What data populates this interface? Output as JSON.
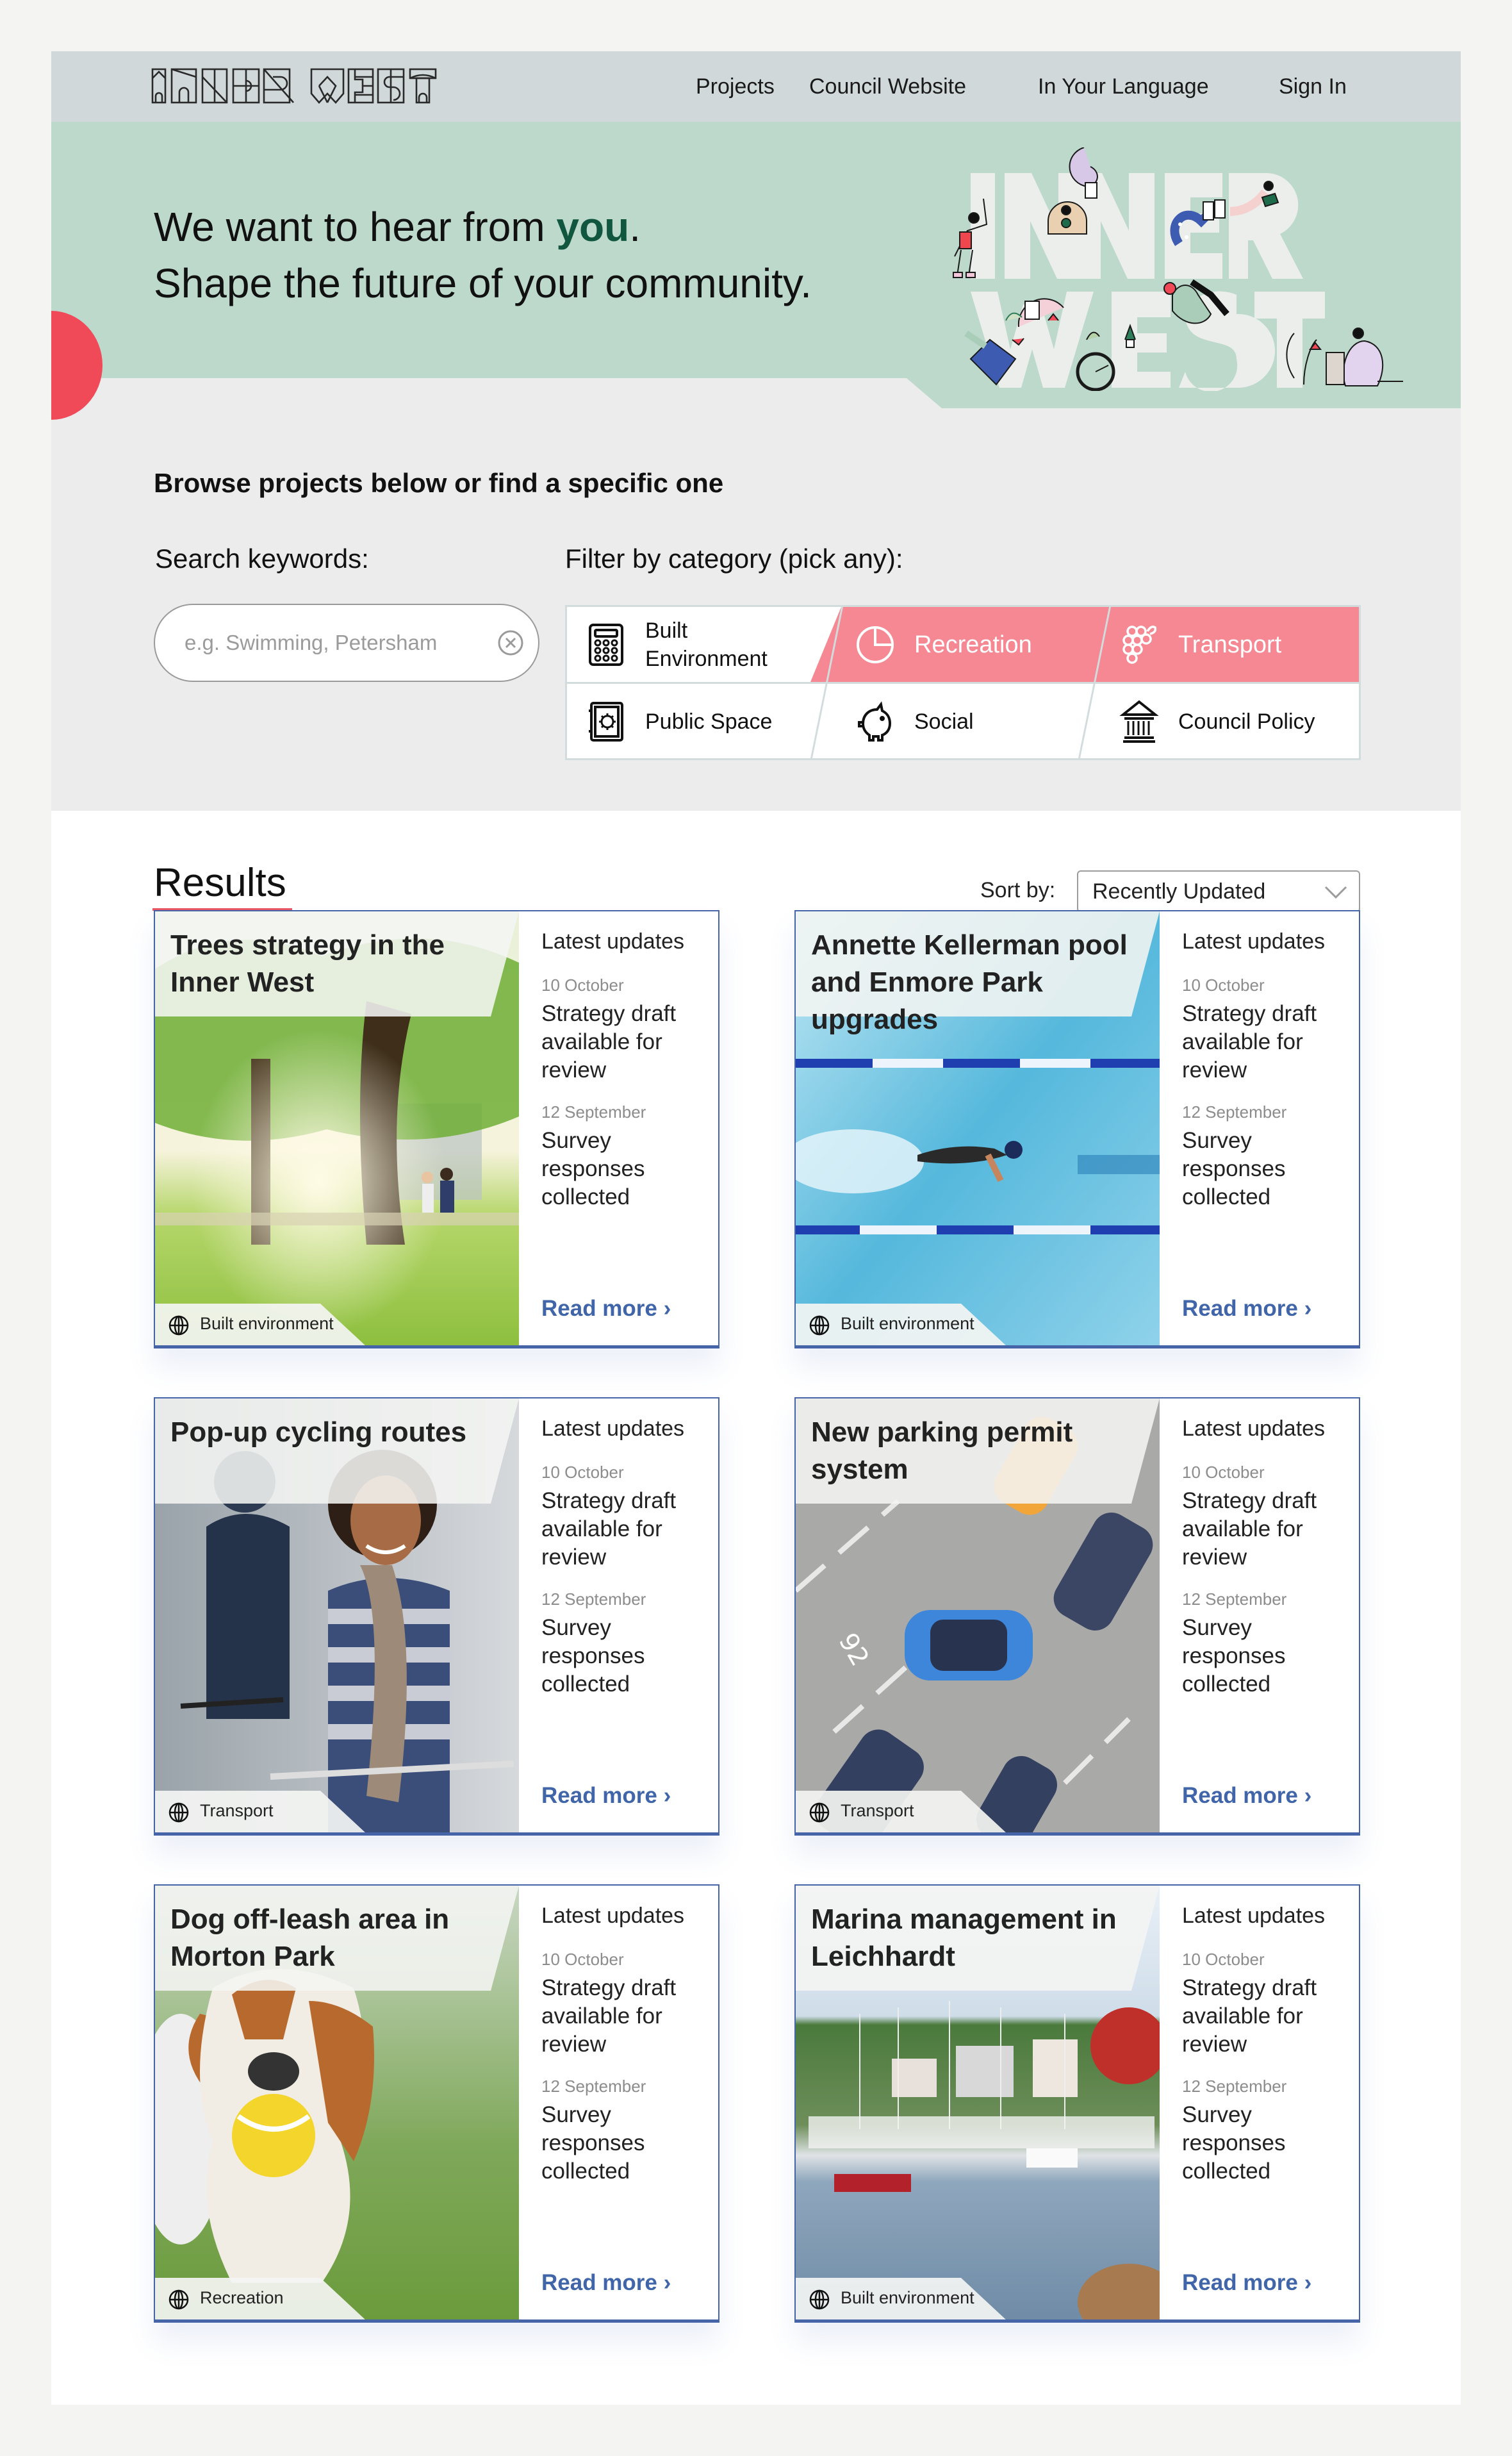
{
  "header": {
    "logo_text": "INNER WEST",
    "nav": [
      {
        "label": "Projects"
      },
      {
        "label": "Council Website"
      },
      {
        "label": "In Your Language"
      },
      {
        "label": "Sign In"
      }
    ]
  },
  "hero": {
    "line1_prefix": "We want to hear from ",
    "line1_accent": "you",
    "line1_suffix": ".",
    "line2": "Shape the future of your community.",
    "illustration_text": "INNER WEST"
  },
  "browse": {
    "title": "Browse projects below or find a specific one",
    "search_label": "Search keywords:",
    "search_placeholder": "e.g. Swimming, Petersham",
    "search_value": "",
    "filter_label": "Filter by category (pick any):",
    "categories": [
      {
        "label": "Built Environment",
        "icon": "calculator-icon",
        "active": false
      },
      {
        "label": "Recreation",
        "icon": "pie-chart-icon",
        "active": true
      },
      {
        "label": "Transport",
        "icon": "grapes-icon",
        "active": true
      },
      {
        "label": "Public Space",
        "icon": "safe-icon",
        "active": false
      },
      {
        "label": "Social",
        "icon": "piggy-bank-icon",
        "active": false
      },
      {
        "label": "Council Policy",
        "icon": "bank-building-icon",
        "active": false
      }
    ]
  },
  "results": {
    "title": "Results",
    "sort_label": "Sort by:",
    "sort_value": "Recently Updated",
    "latest_updates_label": "Latest updates",
    "read_more_label": "Read more ›",
    "cards": [
      {
        "title": "Trees strategy in the Inner West",
        "tag": "Built environment",
        "image": "park-trees-joggers",
        "updates": [
          {
            "date": "10 October",
            "text": "Strategy draft available for review"
          },
          {
            "date": "12 September",
            "text": "Survey responses collected"
          }
        ]
      },
      {
        "title": "Annette Kellerman pool and Enmore Park upgrades",
        "tag": "Built environment",
        "image": "swimming-pool",
        "updates": [
          {
            "date": "10 October",
            "text": "Strategy draft available for review"
          },
          {
            "date": "12 September",
            "text": "Survey responses collected"
          }
        ]
      },
      {
        "title": "Pop-up cycling routes",
        "tag": "Transport",
        "image": "cyclists",
        "updates": [
          {
            "date": "10 October",
            "text": "Strategy draft available for review"
          },
          {
            "date": "12 September",
            "text": "Survey responses collected"
          }
        ]
      },
      {
        "title": "New parking permit system",
        "tag": "Transport",
        "image": "parked-cars",
        "updates": [
          {
            "date": "10 October",
            "text": "Strategy draft available for review"
          },
          {
            "date": "12 September",
            "text": "Survey responses collected"
          }
        ]
      },
      {
        "title": "Dog off-leash area in Morton Park",
        "tag": "Recreation",
        "image": "beagle-with-ball",
        "updates": [
          {
            "date": "10 October",
            "text": "Strategy draft available for review"
          },
          {
            "date": "12 September",
            "text": "Survey responses collected"
          }
        ]
      },
      {
        "title": "Marina management in Leichhardt",
        "tag": "Built environment",
        "image": "marina-boats",
        "updates": [
          {
            "date": "10 October",
            "text": "Strategy draft available for review"
          },
          {
            "date": "12 September",
            "text": "Survey responses collected"
          }
        ]
      }
    ]
  },
  "colors": {
    "header_bg": "#d0d8d9",
    "hero_green": "#bcd9cc",
    "accent_green": "#11573f",
    "accent_red": "#f04a59",
    "filter_active": "#f58892",
    "card_border": "#4565a8",
    "link_blue": "#4065a8"
  }
}
